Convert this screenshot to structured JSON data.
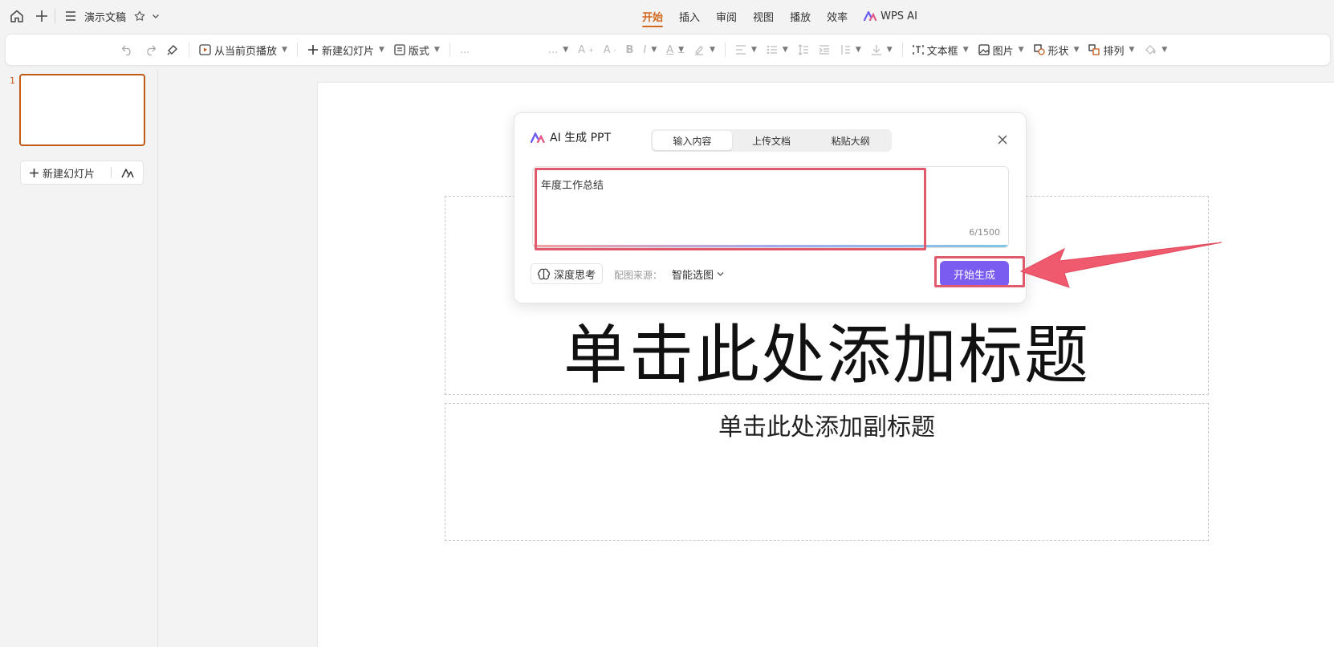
{
  "app": {
    "doc_title": "演示文稿",
    "menu_tabs": [
      "开始",
      "插入",
      "审阅",
      "视图",
      "播放",
      "效率",
      "WPS AI"
    ],
    "active_tab": "开始"
  },
  "toolbar": {
    "play_from_current": "从当前页播放",
    "new_slide": "新建幻灯片",
    "layout": "版式",
    "font_name": "...",
    "font_size": "...",
    "textbox": "文本框",
    "picture": "图片",
    "shape": "形状",
    "arrange": "排列"
  },
  "sidebar": {
    "slide_number": "1",
    "new_slide_button": "新建幻灯片"
  },
  "slide": {
    "title_placeholder": "单击此处添加标题",
    "subtitle_placeholder": "单击此处添加副标题"
  },
  "ai_dialog": {
    "title": "AI 生成 PPT",
    "tabs": [
      "输入内容",
      "上传文档",
      "粘贴大纲"
    ],
    "active_tab": "输入内容",
    "input_value": "年度工作总结",
    "char_count": "6/1500",
    "deep_think": "深度思考",
    "image_source_label": "配图来源：",
    "image_source_value": "智能选图",
    "generate_button": "开始生成"
  },
  "colors": {
    "accent_tab": "#d2691e",
    "generate_button": "#7b5cf0",
    "highlight": "#e05a6c"
  }
}
